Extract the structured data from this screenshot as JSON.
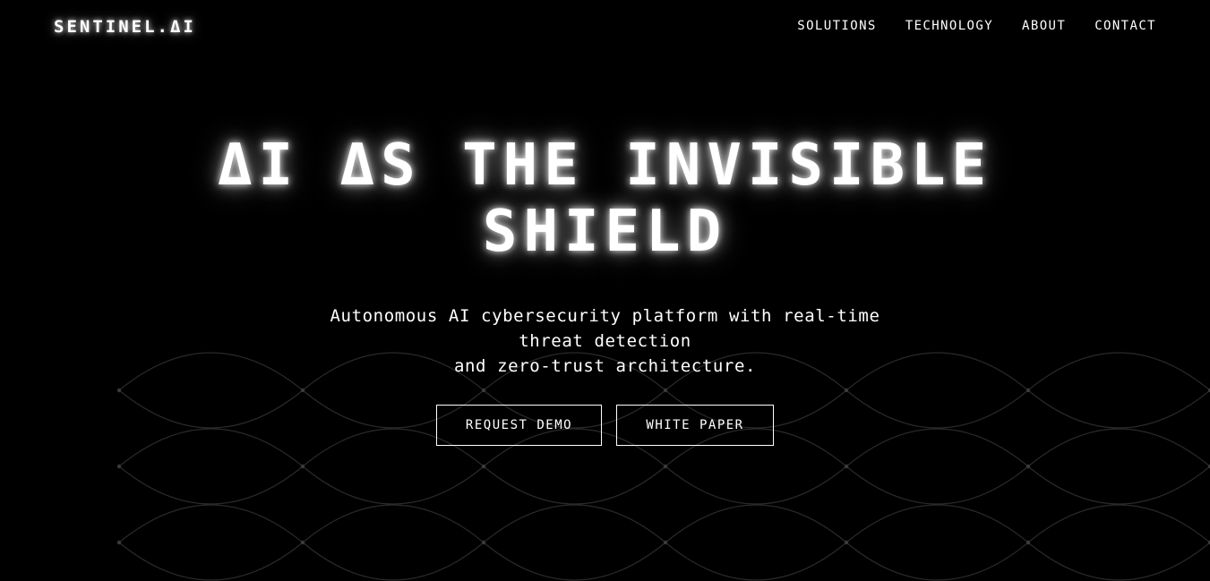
{
  "nav": {
    "logo": "SENTINEL.ΔI",
    "links": [
      "SOLUTIONS",
      "TECHNOLOGY",
      "ABOUT",
      "CONTACT"
    ]
  },
  "hero": {
    "headline": "ΔI ΔS THE INVISIBLE SHIELD",
    "subtitle": "Autonomous AI cybersecurity platform with real-time threat detection\nand zero-trust architecture.",
    "buttons": {
      "primary": "REQUEST DEMO",
      "secondary": "WHITE PAPER"
    }
  },
  "colors": {
    "background": "#000000",
    "text": "#ffffff",
    "pattern_line": "#2a2a2a",
    "pattern_dot": "#3a3a3a"
  }
}
